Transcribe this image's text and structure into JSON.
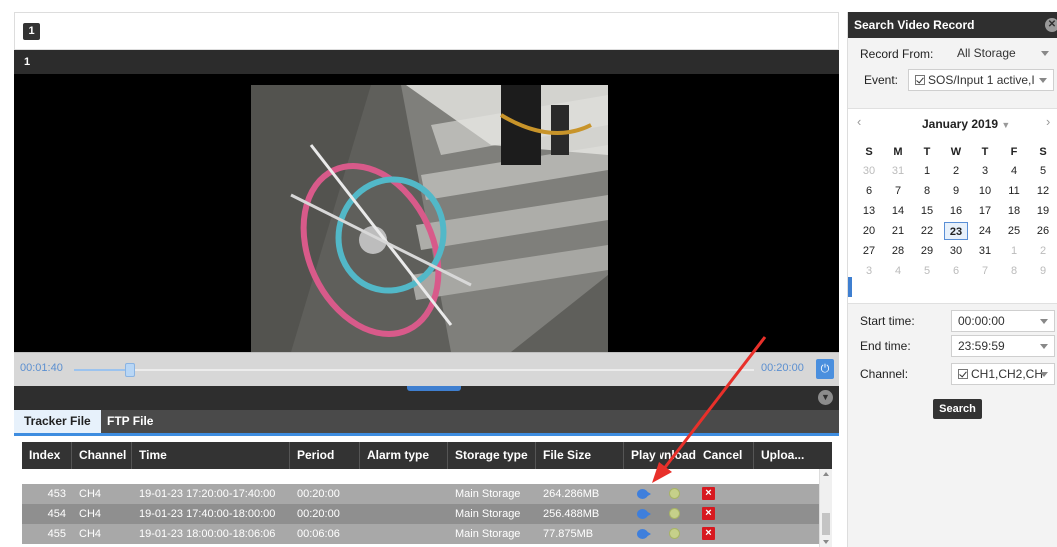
{
  "window": {
    "badge": "1",
    "video_label": "1"
  },
  "timeline": {
    "start": "00:01:40",
    "end": "00:20:00",
    "progress_fraction": 0.083
  },
  "tabs": [
    {
      "label": "Tracker File"
    },
    {
      "label": "FTP File"
    }
  ],
  "table": {
    "columns": [
      "Index",
      "Channel",
      "Time",
      "Period",
      "Alarm type",
      "Storage type",
      "File Size",
      "Play",
      "Download",
      "Cancel",
      "Uploa..."
    ],
    "rows": [
      {
        "index": "453",
        "channel": "CH4",
        "time": "19-01-23 17:20:00-17:40:00",
        "period": "00:20:00",
        "alarm": "",
        "storage": "Main Storage",
        "size": "264.286MB"
      },
      {
        "index": "454",
        "channel": "CH4",
        "time": "19-01-23 17:40:00-18:00:00",
        "period": "00:20:00",
        "alarm": "",
        "storage": "Main Storage",
        "size": "256.488MB"
      },
      {
        "index": "455",
        "channel": "CH4",
        "time": "19-01-23 18:00:00-18:06:06",
        "period": "00:06:06",
        "alarm": "",
        "storage": "Main Storage",
        "size": "77.875MB"
      }
    ]
  },
  "search": {
    "title": "Search Video Record",
    "record_from_label": "Record From:",
    "record_from_value": "All Storage",
    "event_label": "Event:",
    "event_value": "SOS/Input 1 active,I",
    "calendar": {
      "title": "January 2019",
      "dow": [
        "S",
        "M",
        "T",
        "W",
        "T",
        "F",
        "S"
      ],
      "weeks": [
        [
          "30",
          "31",
          "1",
          "2",
          "3",
          "4",
          "5"
        ],
        [
          "6",
          "7",
          "8",
          "9",
          "10",
          "11",
          "12"
        ],
        [
          "13",
          "14",
          "15",
          "16",
          "17",
          "18",
          "19"
        ],
        [
          "20",
          "21",
          "22",
          "23",
          "24",
          "25",
          "26"
        ],
        [
          "27",
          "28",
          "29",
          "30",
          "31",
          "1",
          "2"
        ],
        [
          "3",
          "4",
          "5",
          "6",
          "7",
          "8",
          "9"
        ]
      ],
      "selected": "23"
    },
    "start_label": "Start time:",
    "start_value": "00:00:00",
    "end_label": "End time:",
    "end_value": "23:59:59",
    "channel_label": "Channel:",
    "channel_value": "CH1,CH2,CH",
    "search_button": "Search"
  },
  "colors": {
    "accent": "#3e8de0",
    "header_dark": "#333333",
    "cancel_red": "#d71920",
    "annotation_arrow": "#e8302a"
  }
}
